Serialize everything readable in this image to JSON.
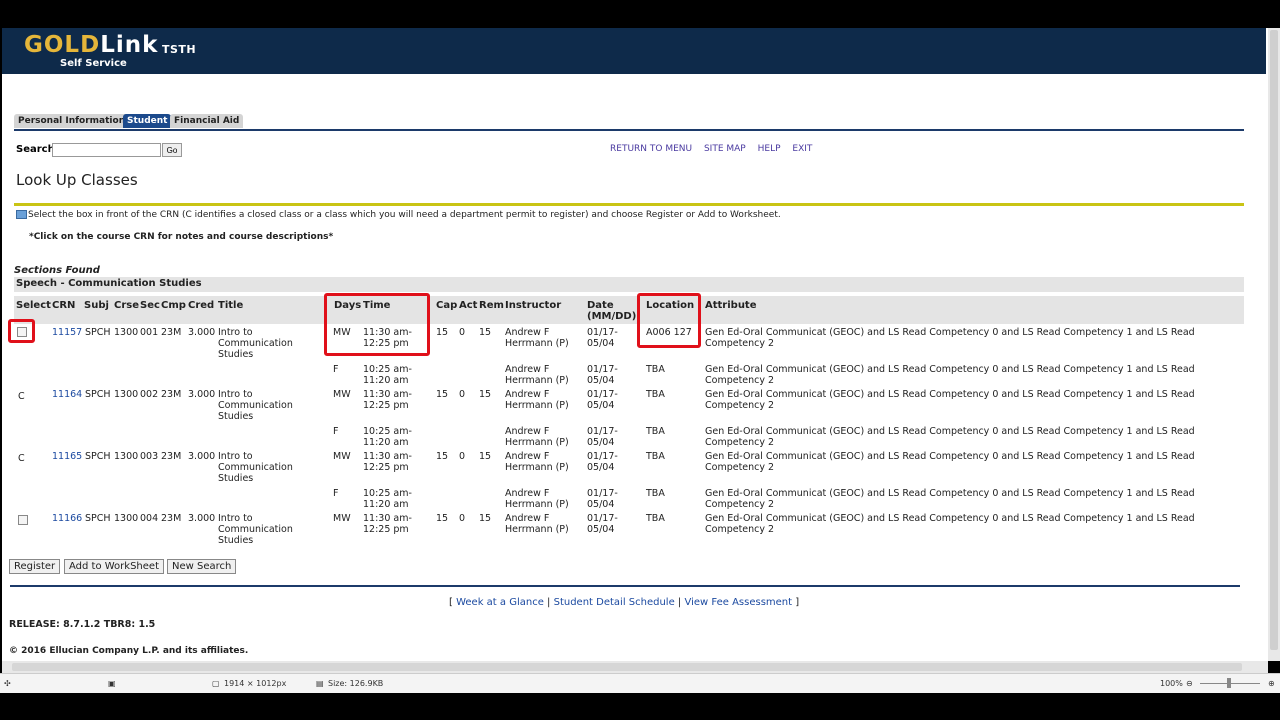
{
  "header": {
    "logo_gold": "GOLD",
    "logo_link": "Link",
    "logo_tag": "TSTH",
    "logo_sub": "Self Service"
  },
  "tabs": [
    {
      "label": "Personal Information"
    },
    {
      "label": "Student",
      "active": true
    },
    {
      "label": "Financial Aid"
    }
  ],
  "search": {
    "label": "Search",
    "value": "",
    "placeholder": "",
    "go_label": "Go"
  },
  "toplinks": [
    "RETURN TO MENU",
    "SITE MAP",
    "HELP",
    "EXIT"
  ],
  "page_title": "Look Up Classes",
  "info_text": "Select the box in front of the CRN (C identifies a closed class or a class which you will need a department permit to register) and choose Register or Add to Worksheet.",
  "click_note": "*Click on the course CRN for notes and course descriptions*",
  "sections_found": "Sections Found",
  "subject": "Speech - Communication Studies",
  "columns": [
    "Select",
    "CRN",
    "Subj",
    "Crse",
    "Sec",
    "Cmp",
    "Cred",
    "Title",
    "Days",
    "Time",
    "Cap",
    "Act",
    "Rem",
    "Instructor",
    "Date (MM/DD)",
    "Location",
    "Attribute"
  ],
  "rows": [
    {
      "select": "checkbox",
      "crn": "11157",
      "subj": "SPCH",
      "crse": "1300",
      "sec": "001",
      "cmp": "23M",
      "cred": "3.000",
      "title": "Intro to Communication Studies",
      "days": "MW",
      "time": "11:30 am-12:25 pm",
      "cap": "15",
      "act": "0",
      "rem": "15",
      "instructor": "Andrew F Herrmann (P)",
      "date": "01/17-05/04",
      "location": "A006 127",
      "attribute": "Gen Ed-Oral Communicat (GEOC) and LS Read Competency 0 and LS Read Competency 1 and LS Read Competency 2"
    },
    {
      "select": "",
      "crn": "",
      "days": "F",
      "time": "10:25 am-11:20 am",
      "instructor": "Andrew F Herrmann (P)",
      "date": "01/17-05/04",
      "location": "TBA",
      "attribute": "Gen Ed-Oral Communicat (GEOC) and LS Read Competency 0 and LS Read Competency 1 and LS Read Competency 2"
    },
    {
      "select": "C",
      "crn": "11164",
      "subj": "SPCH",
      "crse": "1300",
      "sec": "002",
      "cmp": "23M",
      "cred": "3.000",
      "title": "Intro to Communication Studies",
      "days": "MW",
      "time": "11:30 am-12:25 pm",
      "cap": "15",
      "act": "0",
      "rem": "15",
      "instructor": "Andrew F Herrmann (P)",
      "date": "01/17-05/04",
      "location": "TBA",
      "attribute": "Gen Ed-Oral Communicat (GEOC) and LS Read Competency 0 and LS Read Competency 1 and LS Read Competency 2"
    },
    {
      "select": "",
      "crn": "",
      "days": "F",
      "time": "10:25 am-11:20 am",
      "instructor": "Andrew F Herrmann (P)",
      "date": "01/17-05/04",
      "location": "TBA",
      "attribute": "Gen Ed-Oral Communicat (GEOC) and LS Read Competency 0 and LS Read Competency 1 and LS Read Competency 2"
    },
    {
      "select": "C",
      "crn": "11165",
      "subj": "SPCH",
      "crse": "1300",
      "sec": "003",
      "cmp": "23M",
      "cred": "3.000",
      "title": "Intro to Communication Studies",
      "days": "MW",
      "time": "11:30 am-12:25 pm",
      "cap": "15",
      "act": "0",
      "rem": "15",
      "instructor": "Andrew F Herrmann (P)",
      "date": "01/17-05/04",
      "location": "TBA",
      "attribute": "Gen Ed-Oral Communicat (GEOC) and LS Read Competency 0 and LS Read Competency 1 and LS Read Competency 2"
    },
    {
      "select": "",
      "crn": "",
      "days": "F",
      "time": "10:25 am-11:20 am",
      "instructor": "Andrew F Herrmann (P)",
      "date": "01/17-05/04",
      "location": "TBA",
      "attribute": "Gen Ed-Oral Communicat (GEOC) and LS Read Competency 0 and LS Read Competency 1 and LS Read Competency 2"
    },
    {
      "select": "checkbox",
      "crn": "11166",
      "subj": "SPCH",
      "crse": "1300",
      "sec": "004",
      "cmp": "23M",
      "cred": "3.000",
      "title": "Intro to Communication Studies",
      "days": "MW",
      "time": "11:30 am-12:25 pm",
      "cap": "15",
      "act": "0",
      "rem": "15",
      "instructor": "Andrew F Herrmann (P)",
      "date": "01/17-05/04",
      "location": "TBA",
      "attribute": "Gen Ed-Oral Communicat (GEOC) and LS Read Competency 0 and LS Read Competency 1 and LS Read Competency 2"
    }
  ],
  "buttons": [
    "Register",
    "Add to WorkSheet",
    "New Search"
  ],
  "bottom_links": [
    "Week at a Glance",
    "Student Detail Schedule",
    "View Fee Assessment"
  ],
  "release": "RELEASE: 8.7.1.2 TBR8: 1.5",
  "copyright": "© 2016 Ellucian Company L.P. and its affiliates.",
  "statusbar": {
    "dimensions": "1914 × 1012px",
    "size": "Size: 126.9KB",
    "zoom": "100%"
  },
  "colors": {
    "header_bg": "#0e2a4a",
    "logo_gold": "#e5b63a",
    "tab_active": "#1c4a8c",
    "accent_line": "#c9c414",
    "link": "#1c4aa0",
    "annotation": "#e0101a"
  }
}
